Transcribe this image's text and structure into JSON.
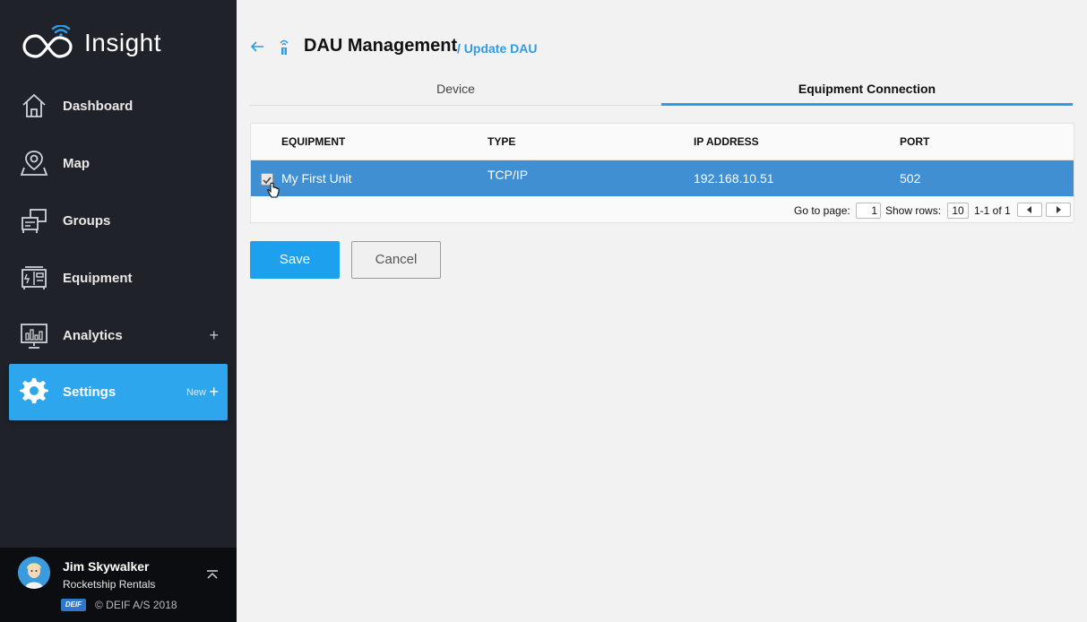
{
  "brand": {
    "name": "Insight"
  },
  "sidebar": {
    "items": [
      {
        "label": "Dashboard",
        "icon": "home-icon"
      },
      {
        "label": "Map",
        "icon": "map-pin-icon"
      },
      {
        "label": "Groups",
        "icon": "groups-icon"
      },
      {
        "label": "Equipment",
        "icon": "equipment-icon"
      },
      {
        "label": "Analytics",
        "icon": "analytics-icon",
        "expand": "+"
      },
      {
        "label": "Settings",
        "icon": "gear-icon",
        "badge": "New",
        "expand": "+",
        "active": true
      }
    ],
    "active_color": "#2ea6ee"
  },
  "user": {
    "name": "Jim Skywalker",
    "company": "Rocketship Rentals",
    "badge": "DEIF",
    "copyright": "© DEIF A/S 2018"
  },
  "header": {
    "title": "DAU Management",
    "breadcrumb": "/ Update DAU"
  },
  "tabs": [
    {
      "label": "Device",
      "active": false
    },
    {
      "label": "Equipment Connection",
      "active": true
    }
  ],
  "table": {
    "columns": [
      "EQUIPMENT",
      "TYPE",
      "IP ADDRESS",
      "PORT"
    ],
    "rows": [
      {
        "equipment": "My First Unit",
        "type": "TCP/IP",
        "ip": "192.168.10.51",
        "port": "502",
        "selected": true
      }
    ],
    "pager": {
      "goto_label": "Go to page:",
      "page": "1",
      "rows_label": "Show rows:",
      "rows": "10",
      "range": "1-1 of 1"
    }
  },
  "actions": {
    "save": "Save",
    "cancel": "Cancel"
  },
  "colors": {
    "sidebar_bg": "#1f2329",
    "accent": "#1da1ef",
    "selected_row": "#3f8fd2"
  }
}
